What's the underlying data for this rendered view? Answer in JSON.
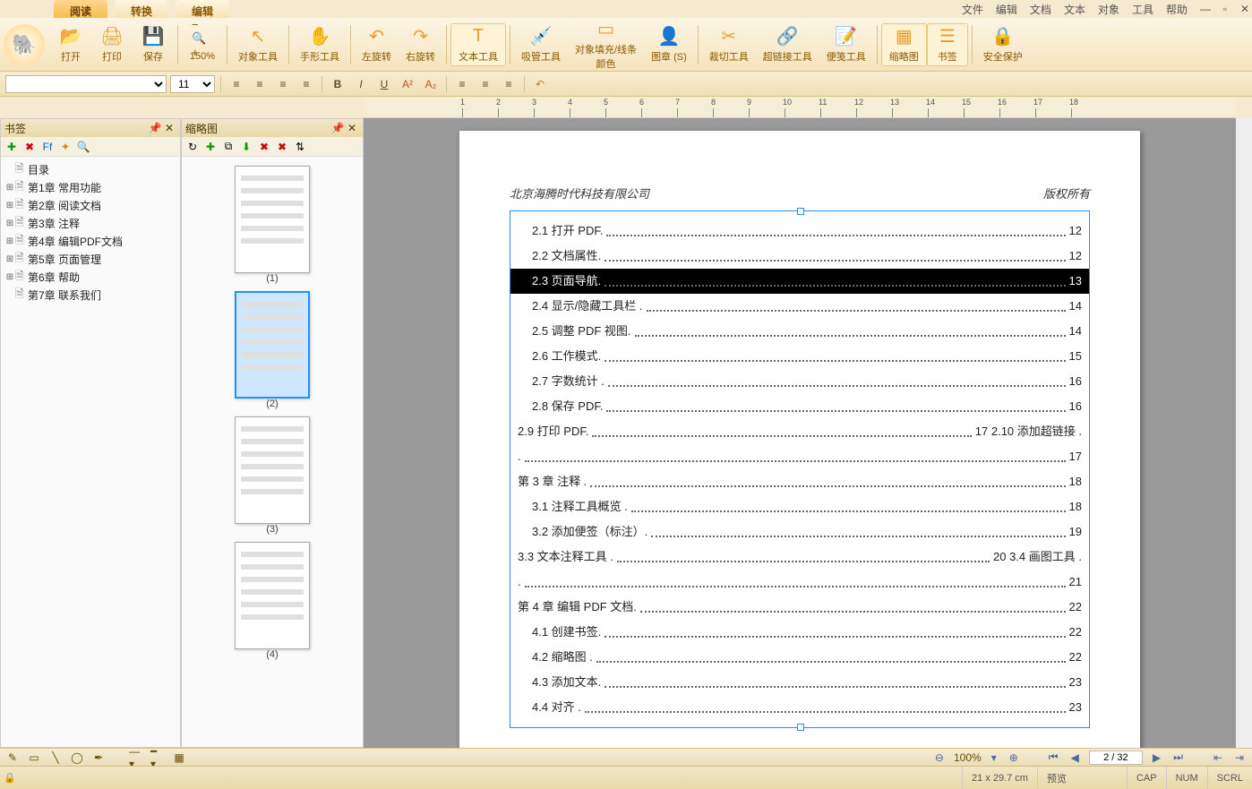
{
  "menu": {
    "file": "文件",
    "edit": "编辑",
    "document": "文档",
    "text": "文本",
    "object": "对象",
    "tool": "工具",
    "help": "帮助"
  },
  "tabs": {
    "read": "阅读",
    "convert": "转换",
    "edit": "编辑"
  },
  "ribbon": {
    "open": "打开",
    "print": "打印",
    "save": "保存",
    "zoom": "150%",
    "objtool": "对象工具",
    "handtool": "手形工具",
    "rotleft": "左旋转",
    "rotright": "右旋转",
    "texttool": "文本工具",
    "eyedrop": "吸管工具",
    "fillline": "对象填充/线条\n颜色",
    "stamp": "图章 (S)",
    "crop": "裁切工具",
    "link": "超链接工具",
    "note": "便笺工具",
    "thumb": "缩略图",
    "bookmark": "书签",
    "security": "安全保护"
  },
  "format": {
    "fontsize": "11"
  },
  "panels": {
    "bookmark": "书签",
    "thumbnail": "缩略图"
  },
  "bookmarks": [
    {
      "toggle": "",
      "label": "目录"
    },
    {
      "toggle": "⊞",
      "label": "第1章 常用功能"
    },
    {
      "toggle": "⊞",
      "label": "第2章 阅读文档"
    },
    {
      "toggle": "⊞",
      "label": "第3章 注释"
    },
    {
      "toggle": "⊞",
      "label": "第4章 编辑PDF文档"
    },
    {
      "toggle": "⊞",
      "label": "第5章 页面管理"
    },
    {
      "toggle": "⊞",
      "label": "第6章 帮助"
    },
    {
      "toggle": "",
      "label": "第7章 联系我们"
    }
  ],
  "thumbs": [
    "(1)",
    "(2)",
    "(3)",
    "(4)"
  ],
  "doc": {
    "header_left": "北京海腾时代科技有限公司",
    "header_right": "版权所有",
    "toc": [
      {
        "t": "2.1 打开 PDF.",
        "p": "12",
        "i": 1
      },
      {
        "t": "2.2 文档属性.",
        "p": "12",
        "i": 1
      },
      {
        "t": "2.3 页面导航.",
        "p": "13",
        "i": 1,
        "hi": true
      },
      {
        "t": "2.4 显示/隐藏工具栏 .",
        "p": "14",
        "i": 1
      },
      {
        "t": "2.5 调整 PDF 视图.",
        "p": "14",
        "i": 1
      },
      {
        "t": "2.6 工作模式.",
        "p": "15",
        "i": 1
      },
      {
        "t": "2.7 字数统计 .",
        "p": "16",
        "i": 1
      },
      {
        "t": "2.8 保存 PDF.",
        "p": "16",
        "i": 1
      },
      {
        "t": "2.9 打印 PDF.",
        "p": "17 2.10 添加超链接 .",
        "i": 0
      },
      {
        "t": ".",
        "p": "17",
        "i": 0
      },
      {
        "t": "第 3 章  注释 .",
        "p": "18",
        "i": 0
      },
      {
        "t": "3.1 注释工具概览 .",
        "p": "18",
        "i": 1
      },
      {
        "t": "3.2 添加便签（标注）.",
        "p": "19",
        "i": 1
      },
      {
        "t": "3.3 文本注释工具 .",
        "p": "20 3.4 画图工具 .",
        "i": 0
      },
      {
        "t": ".",
        "p": "21",
        "i": 0
      },
      {
        "t": "第 4 章  编辑 PDF 文档.",
        "p": "22",
        "i": 0
      },
      {
        "t": "4.1 创建书签.",
        "p": "22",
        "i": 1
      },
      {
        "t": "4.2 缩略图 .",
        "p": "22",
        "i": 1
      },
      {
        "t": "4.3 添加文本.",
        "p": "23",
        "i": 1
      },
      {
        "t": "4.4 对齐 .",
        "p": "23",
        "i": 1
      }
    ]
  },
  "nav": {
    "zoom": "100%",
    "page": "2 / 32"
  },
  "status": {
    "dim": "21 x 29.7 cm",
    "preview": "预览",
    "cap": "CAP",
    "num": "NUM",
    "scrl": "SCRL"
  }
}
